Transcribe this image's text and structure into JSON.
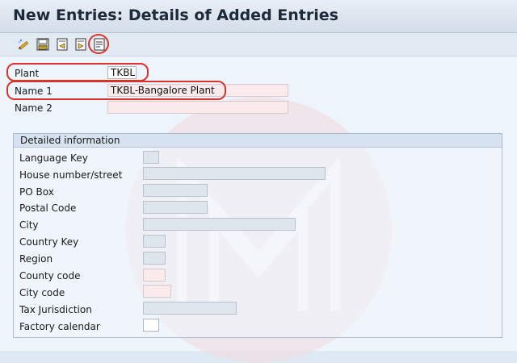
{
  "title": "New Entries: Details of Added Entries",
  "toolbar": {
    "buttons": [
      {
        "icon": "edit-pencil-icon"
      },
      {
        "icon": "save-icon"
      },
      {
        "icon": "previous-entry-icon"
      },
      {
        "icon": "next-entry-icon"
      },
      {
        "icon": "details-icon"
      }
    ]
  },
  "header_fields": {
    "plant": {
      "label": "Plant",
      "value": "TKBL"
    },
    "name1": {
      "label": "Name 1",
      "value": "TKBL-Bangalore Plant"
    },
    "name2": {
      "label": "Name 2",
      "value": ""
    }
  },
  "details": {
    "title": "Detailed information",
    "fields": [
      {
        "label": "Language Key",
        "value": ""
      },
      {
        "label": "House number/street",
        "value": ""
      },
      {
        "label": "PO Box",
        "value": ""
      },
      {
        "label": "Postal Code",
        "value": ""
      },
      {
        "label": "City",
        "value": ""
      },
      {
        "label": "Country Key",
        "value": ""
      },
      {
        "label": "Region",
        "value": ""
      },
      {
        "label": "County code",
        "value": ""
      },
      {
        "label": "City code",
        "value": ""
      },
      {
        "label": "Tax Jurisdiction",
        "value": ""
      },
      {
        "label": "Factory calendar",
        "value": ""
      }
    ]
  },
  "colors": {
    "highlight": "#d9342b",
    "title_bar": "#dce5f0",
    "background": "#eef4fb"
  }
}
